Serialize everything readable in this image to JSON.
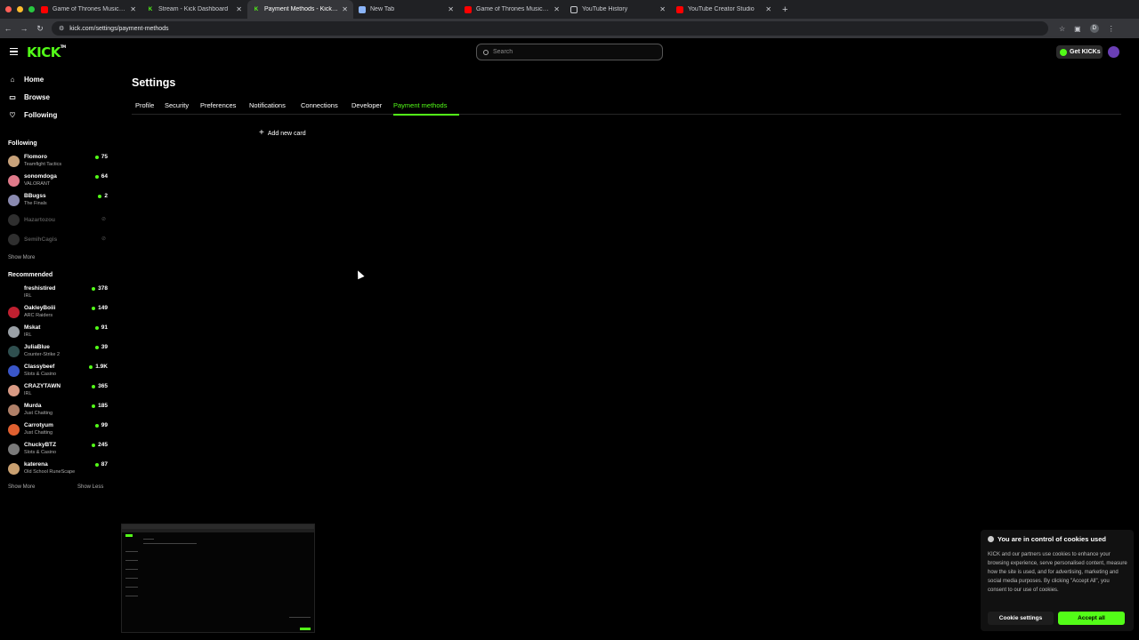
{
  "browser": {
    "tabs": [
      {
        "title": "Game of Thrones Music & Nature",
        "favicon": "youtube-icon"
      },
      {
        "title": "Stream - Kick Dashboard",
        "favicon": "kick-icon"
      },
      {
        "title": "Payment Methods - Kick Stream",
        "favicon": "kick-icon",
        "active": true
      },
      {
        "title": "New Tab",
        "favicon": "chrome-icon"
      },
      {
        "title": "Game of Thrones Music & Nature",
        "favicon": "youtube-icon"
      },
      {
        "title": "YouTube History",
        "favicon": "globe-icon"
      },
      {
        "title": "YouTube Creator Studio",
        "favicon": "youtube-icon"
      }
    ],
    "url": "kick.com/settings/payment-methods",
    "profile_initial": "D"
  },
  "header": {
    "search_placeholder": "Search",
    "get_kicks_label": "Get KICKs",
    "brand_color": "#53fc18"
  },
  "sidebar": {
    "nav": [
      {
        "label": "Home",
        "icon": "home-icon"
      },
      {
        "label": "Browse",
        "icon": "browse-icon"
      },
      {
        "label": "Following",
        "icon": "heart-icon"
      }
    ],
    "following_title": "Following",
    "following": [
      {
        "name": "Flomoro",
        "category": "Teamfight Tactics",
        "viewers": "75",
        "color": "#c8a27a"
      },
      {
        "name": "sonomdoga",
        "category": "VALORANT",
        "viewers": "64",
        "color": "#e07a8a"
      },
      {
        "name": "BBugss",
        "category": "The Finals",
        "viewers": "2",
        "color": "#8a8ab0"
      },
      {
        "name": "Hazartozou",
        "category": "",
        "viewers": "",
        "offline": true,
        "color": "#888"
      },
      {
        "name": "SemihCagis",
        "category": "",
        "viewers": "",
        "offline": true,
        "color": "#888"
      }
    ],
    "show_more_following": "Show More",
    "recommended_title": "Recommended",
    "recommended": [
      {
        "name": "freshistired",
        "category": "IRL",
        "viewers": "378",
        "color": "#000000"
      },
      {
        "name": "OakleyBoiii",
        "category": "ARC Raiders",
        "viewers": "149",
        "color": "#c02030"
      },
      {
        "name": "Mskat",
        "category": "IRL",
        "viewers": "91",
        "color": "#9aa0a6"
      },
      {
        "name": "JuliaBlue",
        "category": "Counter-Strike 2",
        "viewers": "39",
        "color": "#2f4f4f"
      },
      {
        "name": "Classybeef",
        "category": "Slots & Casino",
        "viewers": "1.9K",
        "color": "#3a56c9"
      },
      {
        "name": "CRAZYTAWN",
        "category": "IRL",
        "viewers": "365",
        "color": "#d99a84"
      },
      {
        "name": "Murda",
        "category": "Just Chatting",
        "viewers": "185",
        "color": "#b08068"
      },
      {
        "name": "Carrotyum",
        "category": "Just Chatting",
        "viewers": "99",
        "color": "#e06030"
      },
      {
        "name": "ChuckyBTZ",
        "category": "Slots & Casino",
        "viewers": "245",
        "color": "#7a7a7a"
      },
      {
        "name": "katerena",
        "category": "Old School RuneScape",
        "viewers": "87",
        "color": "#c9a070"
      }
    ],
    "show_more": "Show More",
    "show_less": "Show Less"
  },
  "main": {
    "title": "Settings",
    "tabs": [
      "Profile",
      "Security",
      "Preferences",
      "Notifications",
      "Connections",
      "Developer",
      "Payment methods"
    ],
    "active_tab": "Payment methods",
    "add_card_label": "Add new card"
  },
  "cookie_banner": {
    "title": "You are in control of cookies used",
    "body": "KICK and our partners use cookies to enhance your browsing experience, serve personalised content, measure how the site is used, and for advertising, marketing and social media purposes. By clicking \"Accept All\", you consent to our use of cookies.",
    "settings_label": "Cookie settings",
    "accept_label": "Accept all"
  }
}
